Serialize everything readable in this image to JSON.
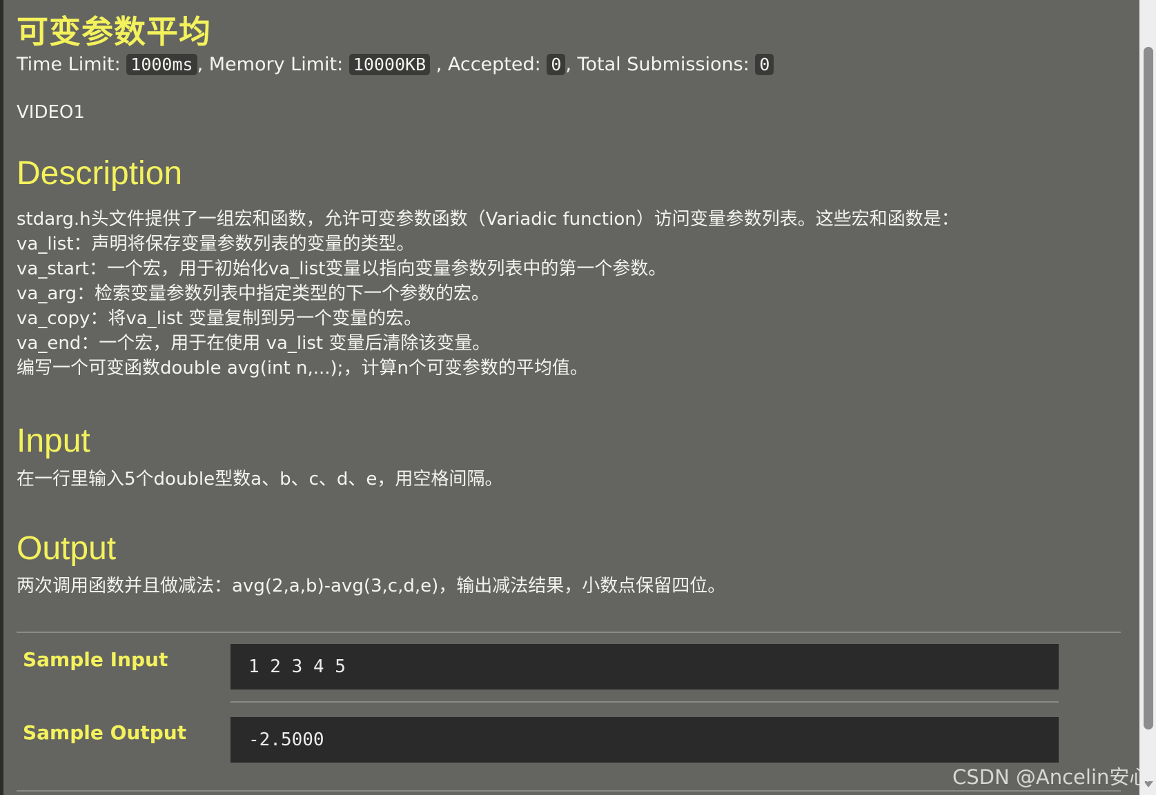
{
  "problem": {
    "title": "可变参数平均",
    "limits": {
      "time_label": "Time Limit: ",
      "time_value": "1000ms",
      "memory_label": ", Memory Limit: ",
      "memory_value": "10000KB",
      "accepted_label": " , Accepted: ",
      "accepted_value": "0",
      "total_label": ", Total Submissions: ",
      "total_value": "0"
    },
    "source": "VIDEO1"
  },
  "description": {
    "heading": "Description",
    "lines": [
      "stdarg.h头文件提供了一组宏和函数，允许可变参数函数（Variadic function）访问变量参数列表。这些宏和函数是：",
      "va_list：声明将保存变量参数列表的变量的类型。",
      "va_start：一个宏，用于初始化va_list变量以指向变量参数列表中的第一个参数。",
      "va_arg：检索变量参数列表中指定类型的下一个参数的宏。",
      "va_copy：将va_list 变量复制到另一个变量的宏。",
      "va_end：一个宏，用于在使用 va_list 变量后清除该变量。",
      "编写一个可变函数double avg(int n,...);，计算n个可变参数的平均值。"
    ]
  },
  "input": {
    "heading": "Input",
    "text": "在一行里输入5个double型数a、b、c、d、e，用空格间隔。"
  },
  "output": {
    "heading": "Output",
    "text": "两次调用函数并且做减法：avg(2,a,b)-avg(3,c,d,e)，输出减法结果，小数点保留四位。"
  },
  "samples": {
    "input_label": "Sample Input",
    "input_value": "1 2 3 4 5",
    "output_label": "Sample Output",
    "output_value": "-2.5000"
  },
  "watermark": "CSDN @Ancelin安心"
}
